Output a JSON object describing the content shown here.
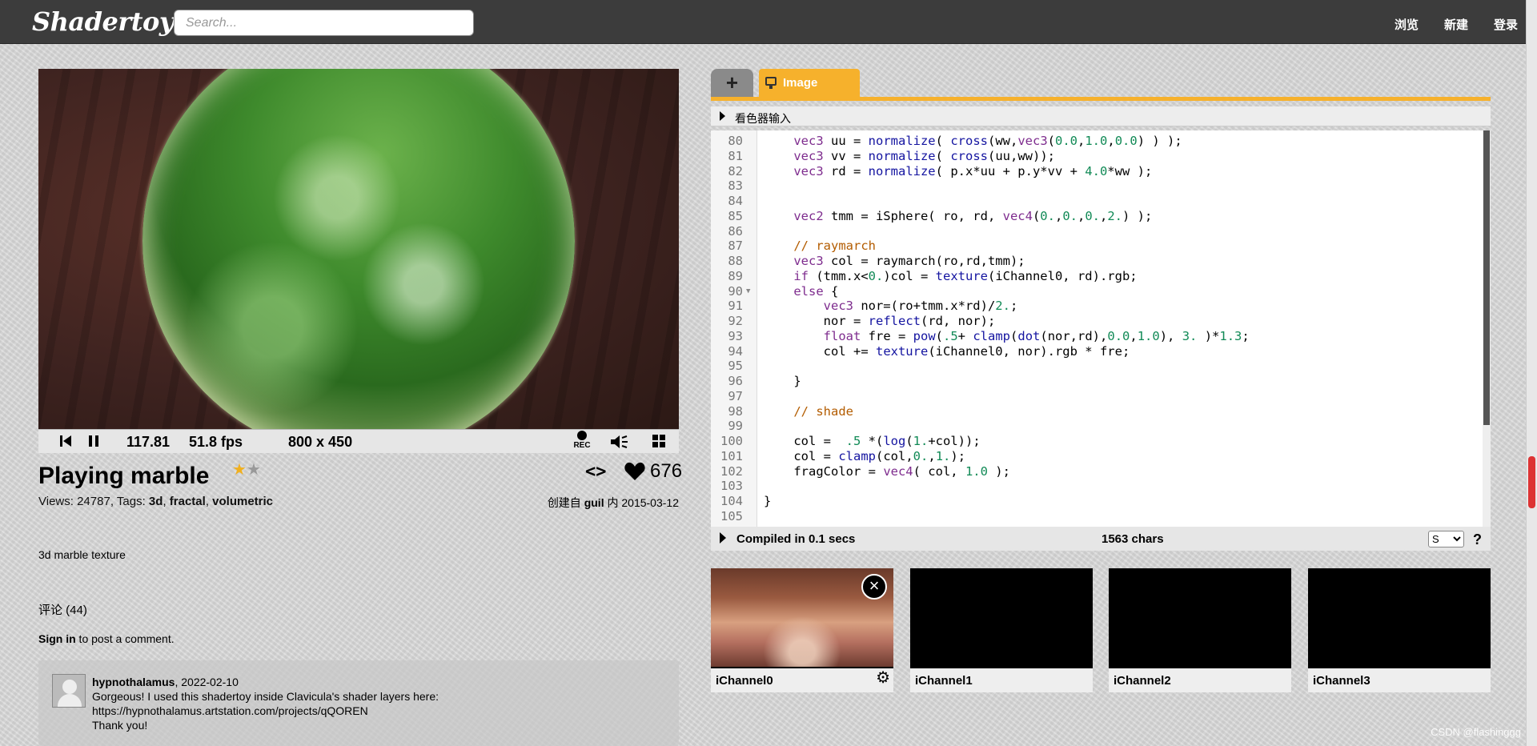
{
  "header": {
    "logo": "Shadertoy",
    "search_placeholder": "Search...",
    "nav": [
      "浏览",
      "新建",
      "登录"
    ]
  },
  "player": {
    "time": "117.81",
    "fps": "51.8 fps",
    "resolution": "800 x 450",
    "rec_label": "REC"
  },
  "shader": {
    "title": "Playing marble",
    "rating_stars_on": 1,
    "rating_stars_total": 2,
    "likes": "676",
    "views_label": "Views:",
    "views": "24787",
    "tags_label": "Tags:",
    "tags": [
      "3d",
      "fractal",
      "volumetric"
    ],
    "created_prefix": "创建自",
    "author": "guil",
    "created_mid": "内",
    "date": "2015-03-12",
    "description": "3d marble texture"
  },
  "comments": {
    "heading": "评论 (44)",
    "signin_link": "Sign in",
    "signin_rest": " to post a comment.",
    "items": [
      {
        "user": "hypnothalamus",
        "date": ", 2022-02-10",
        "lines": [
          "Gorgeous! I used this shadertoy inside Clavicula's shader layers here:",
          "https://hypnothalamus.artstation.com/projects/qQOREN",
          "Thank you!"
        ]
      }
    ]
  },
  "editor": {
    "tab_add": "+",
    "tab_image": "Image",
    "shader_inputs": "看色器输入",
    "lines": [
      {
        "n": "80",
        "html": "    <span class='kw'>vec3</span> uu = <span class='fn'>normalize</span>( <span class='fn'>cross</span>(ww,<span class='kw'>vec3</span>(<span class='num-c'>0.0</span>,<span class='num-c'>1.0</span>,<span class='num-c'>0.0</span>) ) );"
      },
      {
        "n": "81",
        "html": "    <span class='kw'>vec3</span> vv = <span class='fn'>normalize</span>( <span class='fn'>cross</span>(uu,ww));"
      },
      {
        "n": "82",
        "html": "    <span class='kw'>vec3</span> rd = <span class='fn'>normalize</span>( p.x*uu + p.y*vv + <span class='num-c'>4.0</span>*ww );"
      },
      {
        "n": "83",
        "html": ""
      },
      {
        "n": "84",
        "html": ""
      },
      {
        "n": "85",
        "html": "    <span class='kw'>vec2</span> tmm = iSphere( ro, rd, <span class='kw'>vec4</span>(<span class='num-c'>0.</span>,<span class='num-c'>0.</span>,<span class='num-c'>0.</span>,<span class='num-c'>2.</span>) );"
      },
      {
        "n": "86",
        "html": ""
      },
      {
        "n": "87",
        "html": "    <span class='cm'>// raymarch</span>"
      },
      {
        "n": "88",
        "html": "    <span class='kw'>vec3</span> col = raymarch(ro,rd,tmm);"
      },
      {
        "n": "89",
        "html": "    <span class='kw'>if</span> (tmm.x&lt;<span class='num-c'>0.</span>)col = <span class='fn'>texture</span>(iChannel0, rd).rgb;"
      },
      {
        "n": "90",
        "fold": true,
        "html": "    <span class='kw'>else</span> {"
      },
      {
        "n": "91",
        "html": "        <span class='kw'>vec3</span> nor=(ro+tmm.x*rd)/<span class='num-c'>2.</span>;"
      },
      {
        "n": "92",
        "html": "        nor = <span class='fn'>reflect</span>(rd, nor);"
      },
      {
        "n": "93",
        "html": "        <span class='kw'>float</span> fre = <span class='fn'>pow</span>(<span class='num-c'>.5</span>+ <span class='fn'>clamp</span>(<span class='fn'>dot</span>(nor,rd),<span class='num-c'>0.0</span>,<span class='num-c'>1.0</span>), <span class='num-c'>3.</span> )*<span class='num-c'>1.3</span>;"
      },
      {
        "n": "94",
        "html": "        col += <span class='fn'>texture</span>(iChannel0, nor).rgb * fre;"
      },
      {
        "n": "95",
        "html": ""
      },
      {
        "n": "96",
        "html": "    }"
      },
      {
        "n": "97",
        "html": ""
      },
      {
        "n": "98",
        "html": "    <span class='cm'>// shade</span>"
      },
      {
        "n": "99",
        "html": ""
      },
      {
        "n": "100",
        "html": "    col =  <span class='num-c'>.5</span> *(<span class='fn'>log</span>(<span class='num-c'>1.</span>+col));"
      },
      {
        "n": "101",
        "html": "    col = <span class='fn'>clamp</span>(col,<span class='num-c'>0.</span>,<span class='num-c'>1.</span>);"
      },
      {
        "n": "102",
        "html": "    fragColor = <span class='kw'>vec4</span>( col, <span class='num-c'>1.0</span> );"
      },
      {
        "n": "103",
        "html": ""
      },
      {
        "n": "104",
        "html": "}"
      },
      {
        "n": "105",
        "html": ""
      }
    ],
    "compiled": "Compiled in 0.1 secs",
    "chars": "1563 chars",
    "font_size_option": "S",
    "help": "?"
  },
  "channels": [
    "iChannel0",
    "iChannel1",
    "iChannel2",
    "iChannel3"
  ],
  "watermark": "CSDN @flashinggg",
  "colors": {
    "accent": "#f6b12c",
    "topbar": "#3c3c3c"
  }
}
